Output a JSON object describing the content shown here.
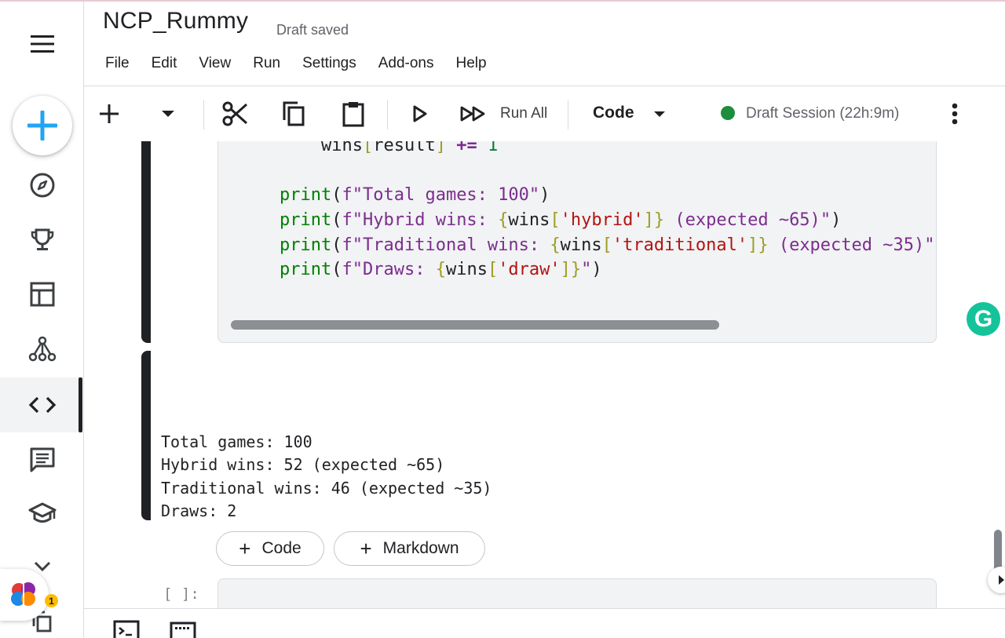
{
  "header": {
    "title": "NCP_Rummy",
    "draft_status": "Draft saved"
  },
  "menu": [
    "File",
    "Edit",
    "View",
    "Run",
    "Settings",
    "Add-ons",
    "Help"
  ],
  "toolbar": {
    "run_all_label": "Run All",
    "cell_type": "Code",
    "session_label": "Draft Session (22h:9m)",
    "session_status_color": "#1e8e3e"
  },
  "code_cell": {
    "lines": [
      "    wins[result] += 1",
      "",
      "print(f\"Total games: 100\")",
      "print(f\"Hybrid wins: {wins['hybrid']} (expected ~65)\")",
      "print(f\"Traditional wins: {wins['traditional']} (expected ~35)\"",
      "print(f\"Draws: {wins['draw']}\")"
    ]
  },
  "output": {
    "lines": [
      "Total games: 100",
      "Hybrid wins: 52 (expected ~65)",
      "Traditional wins: 46 (expected ~35)",
      "Draws: 2"
    ]
  },
  "add_cell": {
    "code_label": "Code",
    "markdown_label": "Markdown"
  },
  "next_cell": {
    "prompt": "[ ]:"
  },
  "extensions": {
    "grammarly_letter": "G",
    "brain_badge": "1"
  },
  "icons": {
    "sidebar": [
      "menu-icon",
      "add-icon",
      "compass-icon",
      "trophy-icon",
      "table-icon",
      "model-icon",
      "code-icon",
      "comment-icon",
      "school-icon",
      "chevron-down-icon",
      "copy-icon"
    ],
    "toolbar": [
      "add-cell-icon",
      "dropdown-icon",
      "cut-icon",
      "copy-icon",
      "paste-icon",
      "run-icon",
      "run-all-icon",
      "more-icon"
    ],
    "bottom": [
      "terminal-icon",
      "keyboard-icon"
    ]
  },
  "colors": {
    "accent": "#1a73e8",
    "cell_active": "#202124",
    "code_bg": "#f1f3f4",
    "string": "#7d2c8f",
    "function": "#008000"
  }
}
